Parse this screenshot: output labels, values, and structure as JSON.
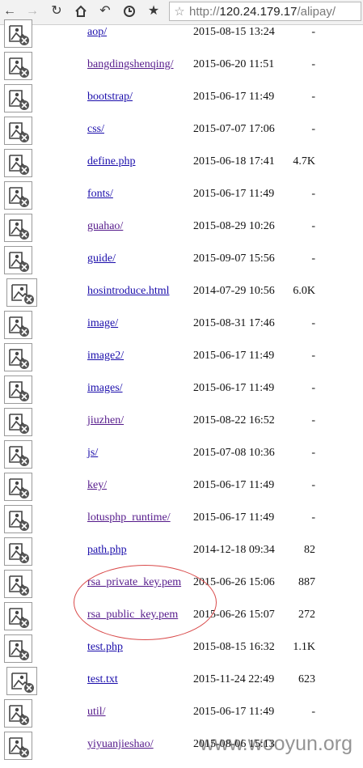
{
  "browser": {
    "url_prefix": "http://",
    "url_host": "120.24.179.17",
    "url_path": "/alipay/",
    "icons": [
      "back-icon",
      "forward-icon",
      "reload-icon",
      "home-icon",
      "undo-icon",
      "history-icon",
      "bookmarks-star-icon",
      "bookmark-page-star-icon"
    ]
  },
  "listing": {
    "rows": [
      {
        "name": "aop/",
        "date": "2015-08-15 13:24",
        "size": "-"
      },
      {
        "name": "bangdingshenqing/",
        "date": "2015-06-20 11:51",
        "size": "-"
      },
      {
        "name": "bootstrap/",
        "date": "2015-06-17 11:49",
        "size": "-"
      },
      {
        "name": "css/",
        "date": "2015-07-07 17:06",
        "size": "-"
      },
      {
        "name": "define.php",
        "date": "2015-06-18 17:41",
        "size": "4.7K"
      },
      {
        "name": "fonts/",
        "date": "2015-06-17 11:49",
        "size": "-"
      },
      {
        "name": "guahao/",
        "date": "2015-08-29 10:26",
        "size": "-"
      },
      {
        "name": "guide/",
        "date": "2015-09-07 15:56",
        "size": "-"
      },
      {
        "name": "hosintroduce.html",
        "date": "2014-07-29 10:56",
        "size": "6.0K"
      },
      {
        "name": "image/",
        "date": "2015-08-31 17:46",
        "size": "-"
      },
      {
        "name": "image2/",
        "date": "2015-06-17 11:49",
        "size": "-"
      },
      {
        "name": "images/",
        "date": "2015-06-17 11:49",
        "size": "-"
      },
      {
        "name": "jiuzhen/",
        "date": "2015-08-22 16:52",
        "size": "-"
      },
      {
        "name": "js/",
        "date": "2015-07-08 10:36",
        "size": "-"
      },
      {
        "name": "key/",
        "date": "2015-06-17 11:49",
        "size": "-"
      },
      {
        "name": "lotusphp_runtime/",
        "date": "2015-06-17 11:49",
        "size": "-"
      },
      {
        "name": "path.php",
        "date": "2014-12-18 09:34",
        "size": "82"
      },
      {
        "name": "rsa_private_key.pem",
        "date": "2015-06-26 15:06",
        "size": "887"
      },
      {
        "name": "rsa_public_key.pem",
        "date": "2015-06-26 15:07",
        "size": "272"
      },
      {
        "name": "test.php",
        "date": "2015-08-15 16:32",
        "size": "1.1K"
      },
      {
        "name": "test.txt",
        "date": "2015-11-24 22:49",
        "size": "623"
      },
      {
        "name": "util/",
        "date": "2015-06-17 11:49",
        "size": "-"
      },
      {
        "name": "yiyuanjieshao/",
        "date": "2015-08-06 15:13",
        "size": ""
      }
    ]
  },
  "annotation": {
    "color": "#d94a4a",
    "highlighted_rows": [
      "rsa_private_key.pem",
      "rsa_public_key.pem"
    ]
  },
  "watermark": {
    "text": "www.wooyun.org"
  }
}
